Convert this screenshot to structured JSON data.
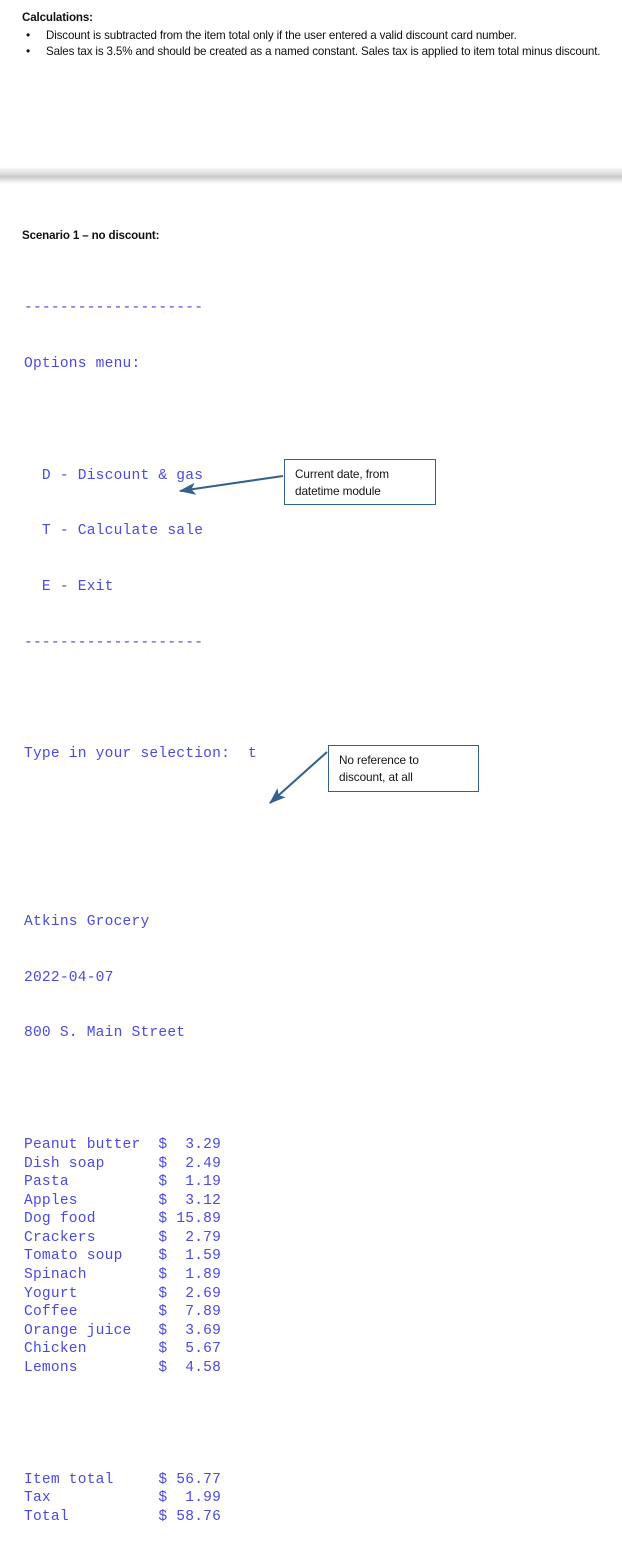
{
  "document": {
    "calculations_heading": "Calculations:",
    "bullets": [
      "Discount is subtracted from the item total only if the user entered a valid discount card number.",
      "Sales tax is 3.5% and should be created as a named constant. Sales tax is applied to item total minus discount."
    ],
    "scenario_label": "Scenario 1 – no discount:"
  },
  "console": {
    "text_color": "#4a4ae0",
    "rule_top": "--------------------",
    "menu_title": "Options menu:",
    "menu_items": [
      "  D - Discount & gas",
      "  T - Calculate sale",
      "  E - Exit"
    ],
    "rule_bottom": "--------------------",
    "prompt_line": "Type in your selection:  t",
    "store_name": "Atkins Grocery",
    "store_date": "2022-04-07",
    "store_address": "800 S. Main Street",
    "receipt_items": [
      {
        "name": "Peanut butter",
        "currency": "$",
        "price": "3.29"
      },
      {
        "name": "Dish soap",
        "currency": "$",
        "price": "2.49"
      },
      {
        "name": "Pasta",
        "currency": "$",
        "price": "1.19"
      },
      {
        "name": "Apples",
        "currency": "$",
        "price": "3.12"
      },
      {
        "name": "Dog food",
        "currency": "$",
        "price": "15.89"
      },
      {
        "name": "Crackers",
        "currency": "$",
        "price": "2.79"
      },
      {
        "name": "Tomato soup",
        "currency": "$",
        "price": "1.59"
      },
      {
        "name": "Spinach",
        "currency": "$",
        "price": "1.89"
      },
      {
        "name": "Yogurt",
        "currency": "$",
        "price": "2.69"
      },
      {
        "name": "Coffee",
        "currency": "$",
        "price": "7.89"
      },
      {
        "name": "Orange juice",
        "currency": "$",
        "price": "3.69"
      },
      {
        "name": "Chicken",
        "currency": "$",
        "price": "5.67"
      },
      {
        "name": "Lemons",
        "currency": "$",
        "price": "4.58"
      }
    ],
    "totals": [
      {
        "name": "Item total",
        "currency": "$",
        "price": "56.77"
      },
      {
        "name": "Tax",
        "currency": "$",
        "price": "1.99"
      },
      {
        "name": "Total",
        "currency": "$",
        "price": "58.76"
      }
    ]
  },
  "callouts": {
    "border_color": "#36618e",
    "date": {
      "line1": "Current date, from",
      "line2": "datetime module"
    },
    "no_discount": {
      "line1": "No reference to",
      "line2": "discount, at all"
    }
  }
}
